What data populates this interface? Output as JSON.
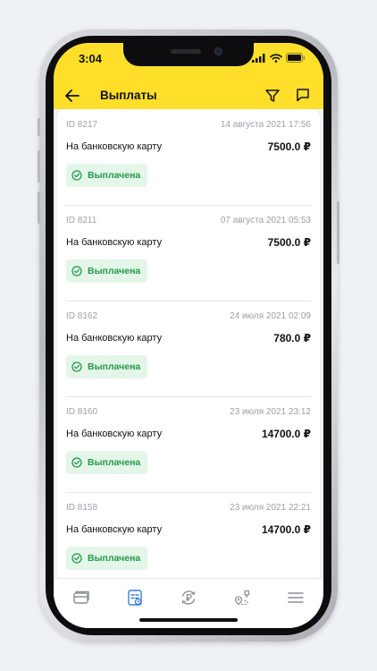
{
  "status": {
    "time": "3:04"
  },
  "header": {
    "title": "Выплаты"
  },
  "payouts": [
    {
      "id": "ID 8217",
      "date": "14 августа 2021 17:56",
      "method": "На банковскую карту",
      "amount": "7500.0 ₽",
      "status": "Выплачена"
    },
    {
      "id": "ID 8211",
      "date": "07 августа 2021 05:53",
      "method": "На банковскую карту",
      "amount": "7500.0 ₽",
      "status": "Выплачена"
    },
    {
      "id": "ID 8162",
      "date": "24 июля 2021 02:09",
      "method": "На банковскую карту",
      "amount": "780.0 ₽",
      "status": "Выплачена"
    },
    {
      "id": "ID 8160",
      "date": "23 июля 2021 23:12",
      "method": "На банковскую карту",
      "amount": "14700.0 ₽",
      "status": "Выплачена"
    },
    {
      "id": "ID 8158",
      "date": "23 июля 2021 22:21",
      "method": "На банковскую карту",
      "amount": "14700.0 ₽",
      "status": "Выплачена"
    }
  ],
  "tabs": [
    {
      "icon": "wallet-icon",
      "active": false
    },
    {
      "icon": "payouts-list-icon",
      "active": true
    },
    {
      "icon": "ruble-exchange-icon",
      "active": false
    },
    {
      "icon": "route-map-icon",
      "active": false
    },
    {
      "icon": "menu-icon",
      "active": false
    }
  ],
  "colors": {
    "brand_yellow": "#ffdf2a",
    "status_green": "#239a47",
    "status_bg": "#e4f6e9",
    "active_tab": "#3c7fd6",
    "inactive_tab": "#8a8f98"
  }
}
